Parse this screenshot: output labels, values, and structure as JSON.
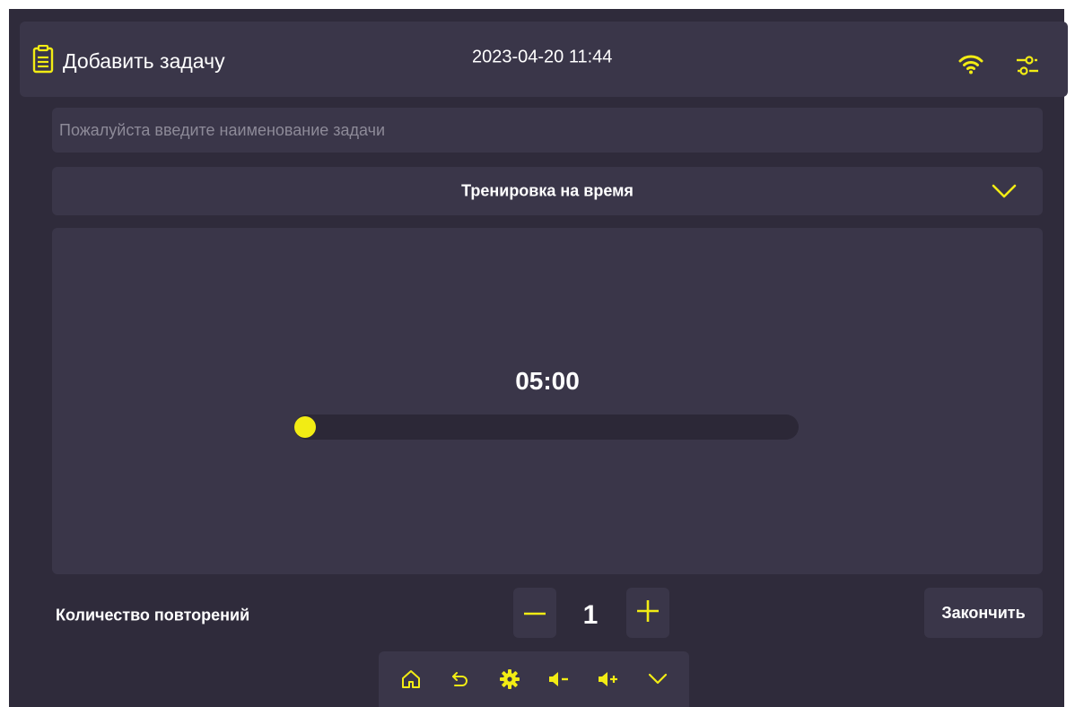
{
  "header": {
    "title": "Добавить задачу",
    "datetime": "2023-04-20 11:44",
    "icons": [
      "clipboard-icon",
      "wifi-icon",
      "settings-sliders-icon"
    ]
  },
  "form": {
    "task_name_placeholder": "Пожалуйста введите наименование задачи",
    "mode_select_value": "Тренировка на время"
  },
  "timer": {
    "display": "05:00",
    "slider_fraction": 0
  },
  "repetitions": {
    "label": "Количество повторений",
    "value": "1"
  },
  "actions": {
    "finish_label": "Закончить"
  },
  "bottom_nav": {
    "icons": [
      "home-icon",
      "back-icon",
      "gear-icon",
      "volume-down-icon",
      "volume-up-icon",
      "chevron-down-icon"
    ]
  },
  "colors": {
    "accent": "#f2ec14",
    "background": "#2f2b3b",
    "surface": "#3a3649",
    "text": "#ffffff",
    "placeholder": "#8d8a98"
  }
}
